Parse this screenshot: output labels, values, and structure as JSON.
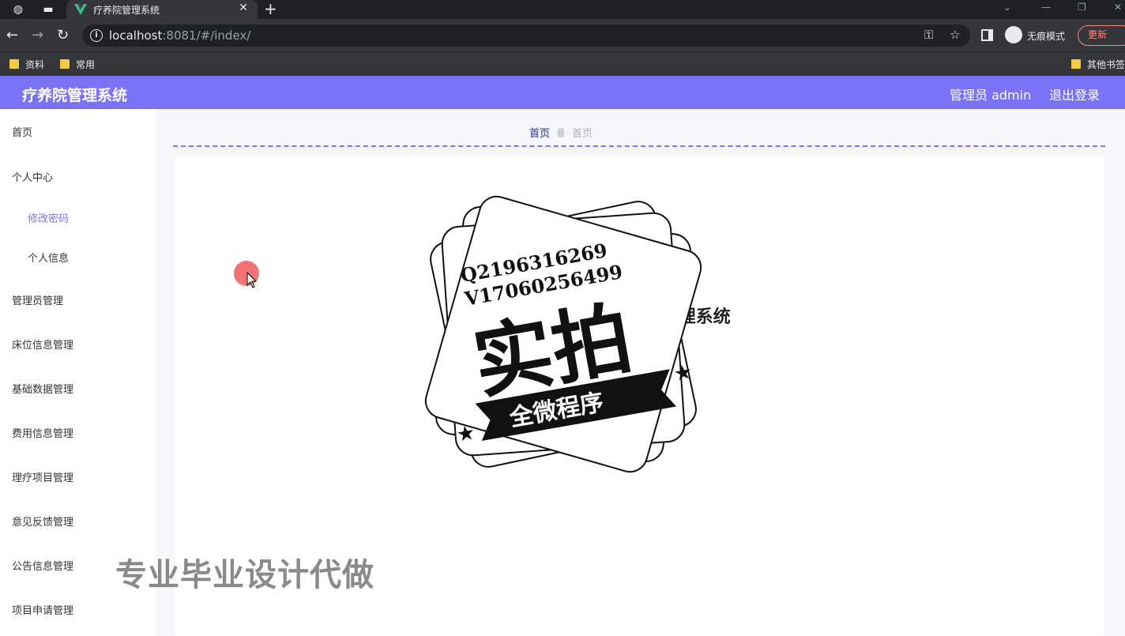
{
  "browser": {
    "tab_title": "疗养院管理系统",
    "url_host": "localhost",
    "url_rest": ":8081/#/index/",
    "incognito_label": "无痕模式",
    "update_label": "更新",
    "bookmarks": [
      "资料",
      "常用",
      "其他书签"
    ]
  },
  "header": {
    "title": "疗养院管理系统",
    "user_label": "管理员 admin",
    "logout_label": "退出登录"
  },
  "sidebar": {
    "items": [
      {
        "label": "首页"
      },
      {
        "label": "个人中心"
      },
      {
        "label": "修改密码"
      },
      {
        "label": "个人信息"
      },
      {
        "label": "管理员管理"
      },
      {
        "label": "床位信息管理"
      },
      {
        "label": "基础数据管理"
      },
      {
        "label": "费用信息管理"
      },
      {
        "label": "理疗项目管理"
      },
      {
        "label": "意见反馈管理"
      },
      {
        "label": "公告信息管理"
      },
      {
        "label": "项目申请管理"
      }
    ]
  },
  "breadcrumb": {
    "home": "首页",
    "current": "首页"
  },
  "main": {
    "welcome": "欢迎使用 疗养院管理系统"
  },
  "overlay": {
    "stamp_line1": "Q2196316269",
    "stamp_line2": "V17060256499",
    "stamp_big": "实拍",
    "stamp_ribbon": "全微程序",
    "promo_text": "专业毕业设计代做"
  },
  "colors": {
    "accent": "#7b72f5"
  }
}
